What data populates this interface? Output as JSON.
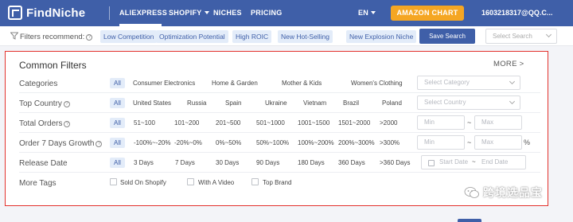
{
  "header": {
    "logo_text": "FindNiche",
    "nav": [
      "ALIEXPRESS",
      "SHOPIFY",
      "NICHES",
      "PRICING"
    ],
    "language": "EN",
    "amazon_button": "AMAZON CHART",
    "account": "1603218317@QQ.C..."
  },
  "recommend": {
    "label": "Filters recommend:",
    "chips": [
      "Low Competition",
      "Optimization Potential",
      "High ROIC",
      "New Hot-Selling",
      "New Explosion Niche"
    ],
    "save_button": "Save Search",
    "select_placeholder": "Select Search"
  },
  "filters": {
    "title": "Common Filters",
    "more": "MORE >",
    "all_label": "All",
    "categories": {
      "label": "Categories",
      "options": [
        "Consumer Electronics",
        "Home & Garden",
        "Mother & Kids",
        "Women's Clothing"
      ],
      "select_placeholder": "Select Category"
    },
    "top_country": {
      "label": "Top Country",
      "options": [
        "United States",
        "Russia",
        "Spain",
        "Ukraine",
        "Vietnam",
        "Brazil",
        "Poland"
      ],
      "select_placeholder": "Select Country"
    },
    "total_orders": {
      "label": "Total Orders",
      "options": [
        "51~100",
        "101~200",
        "201~500",
        "501~1000",
        "1001~1500",
        "1501~2000",
        ">2000"
      ],
      "min_placeholder": "Min",
      "max_placeholder": "Max",
      "range_separator": "~"
    },
    "order_growth": {
      "label": "Order 7 Days Growth",
      "options": [
        "-100%~-20%",
        "-20%~0%",
        "0%~50%",
        "50%~100%",
        "100%~200%",
        "200%~300%",
        ">300%"
      ],
      "min_placeholder": "Min",
      "max_placeholder": "Max",
      "range_separator": "~",
      "unit": "%"
    },
    "release_date": {
      "label": "Release Date",
      "options": [
        "3 Days",
        "7 Days",
        "30 Days",
        "90 Days",
        "180 Days",
        "360 Days",
        ">360 Days"
      ],
      "start_placeholder": "Start Date",
      "end_placeholder": "End Date",
      "range_separator": "~"
    },
    "more_tags": {
      "label": "More Tags",
      "options": [
        "Sold On Shopify",
        "With A Video",
        "Top Brand"
      ]
    }
  },
  "watermark": {
    "text": "跨境选品宝"
  },
  "colors": {
    "brand_blue": "#3f5fa8",
    "amazon_orange": "#f5a623",
    "highlight_red": "#e3322d",
    "chip_bg": "#e3ecf9"
  }
}
